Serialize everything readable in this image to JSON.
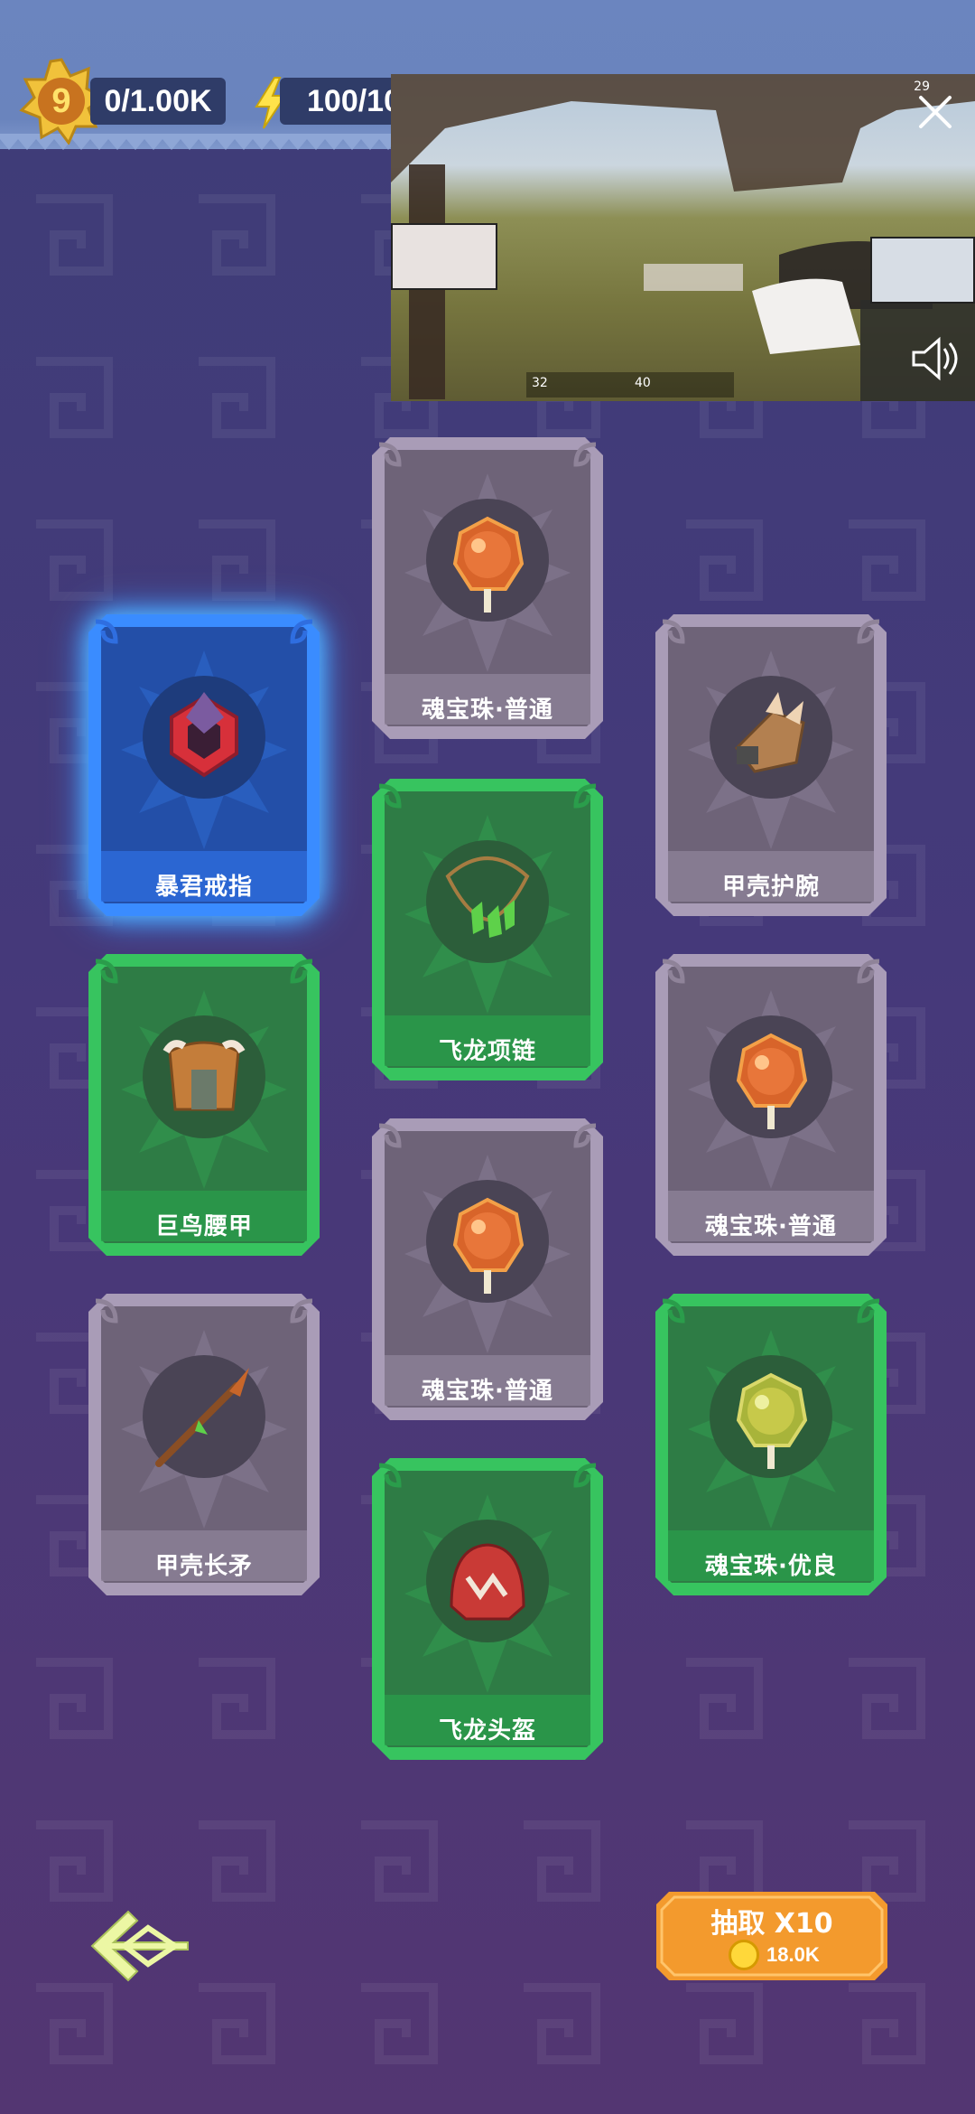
{
  "hud": {
    "level": "9",
    "xp": "0/1.00K",
    "energy": "100/10"
  },
  "video_overlay": {
    "clock": "29 ",
    "speed": "32",
    "ammo": "40"
  },
  "cards": [
    {
      "name": "暴君戒指",
      "rarity": "blue",
      "icon": "ring-icon"
    },
    {
      "name": "魂宝珠·普通",
      "rarity": "gray",
      "icon": "orb-icon"
    },
    {
      "name": "甲壳护腕",
      "rarity": "gray",
      "icon": "bracer-icon"
    },
    {
      "name": "飞龙项链",
      "rarity": "green",
      "icon": "necklace-icon"
    },
    {
      "name": "巨鸟腰甲",
      "rarity": "green",
      "icon": "armor-icon"
    },
    {
      "name": "魂宝珠·普通",
      "rarity": "gray",
      "icon": "orb-icon"
    },
    {
      "name": "魂宝珠·普通",
      "rarity": "gray",
      "icon": "orb-icon"
    },
    {
      "name": "甲壳长矛",
      "rarity": "gray",
      "icon": "spear-icon"
    },
    {
      "name": "魂宝珠·优良",
      "rarity": "green",
      "icon": "orb-icon"
    },
    {
      "name": "飞龙头盔",
      "rarity": "green",
      "icon": "helmet-icon"
    }
  ],
  "draw_button": {
    "label": "抽取 X10",
    "cost": "18.0K"
  },
  "colors": {
    "gray_card": "#a99cb7",
    "green_card": "#37c45f",
    "blue_card": "#3a8cff",
    "draw_button": "#f39a2d"
  }
}
